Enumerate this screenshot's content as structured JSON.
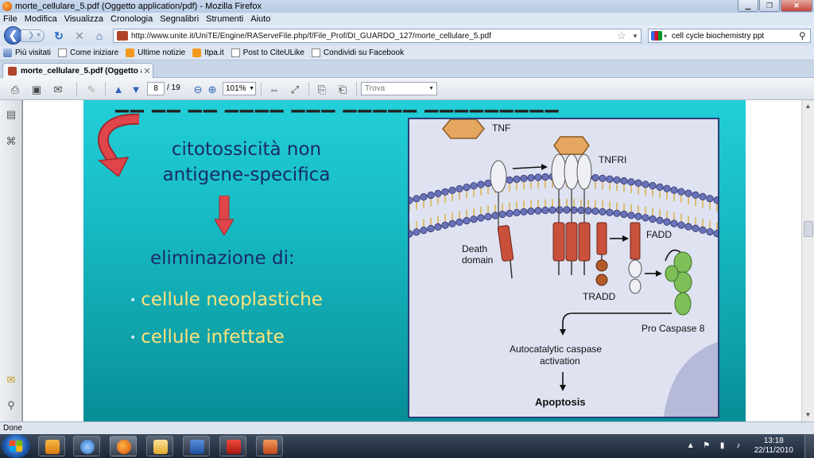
{
  "window": {
    "title": "morte_cellulare_5.pdf (Oggetto application/pdf) - Mozilla Firefox",
    "minimize": "▁",
    "maximize": "❐",
    "close": "✕"
  },
  "menu": [
    "File",
    "Modifica",
    "Visualizza",
    "Cronologia",
    "Segnalibri",
    "Strumenti",
    "Aiuto"
  ],
  "nav": {
    "back_icon": "back-arrow-icon",
    "forward_icon": "forward-arrow-icon",
    "url": "http://www.unite.it/UniTE/Engine/RAServeFile.php/f/File_Prof/DI_GUARDO_127/morte_cellulare_5.pdf",
    "search_query": "cell cycle biochemistry ppt"
  },
  "bookmarks": [
    {
      "label": "Più visitati",
      "icon": "bmk"
    },
    {
      "label": "Come iniziare",
      "icon": "page"
    },
    {
      "label": "Ultime notizie",
      "icon": "rss"
    },
    {
      "label": "Itpa.it",
      "icon": "rss"
    },
    {
      "label": "Post to CiteULike",
      "icon": "page"
    },
    {
      "label": "Condividi su Facebook",
      "icon": "page"
    }
  ],
  "tab": {
    "label": "morte_cellulare_5.pdf (Oggetto appli...",
    "close": "✕"
  },
  "pdf_toolbar": {
    "page_current": "8",
    "page_total": "/ 19",
    "zoom": "101%",
    "find_placeholder": "Trova"
  },
  "slide": {
    "heading_line1": "citotossicità non",
    "heading_line2": "antigene-specifica",
    "elimination": "eliminazione di:",
    "bullets": [
      "cellule neoplastiche",
      "cellule infettate"
    ],
    "colors": {
      "bg_top": "#22cfd8",
      "bg_bottom": "#078d96",
      "text": "#1b2a6b",
      "bullet": "#ffe27a",
      "arrow": "#e0454b"
    }
  },
  "diagram": {
    "tnf": "TNF",
    "tnfri": "TNFRI",
    "death_domain_1": "Death",
    "death_domain_2": "domain",
    "fadd": "FADD",
    "tradd": "TRADD",
    "procaspase": "Pro Caspase 8",
    "autocat_1": "Autocatalytic caspase",
    "autocat_2": "activation",
    "apoptosis": "Apoptosis"
  },
  "status": {
    "text": "Done"
  },
  "taskbar": {
    "time": "13:18",
    "date": "22/11/2010"
  }
}
